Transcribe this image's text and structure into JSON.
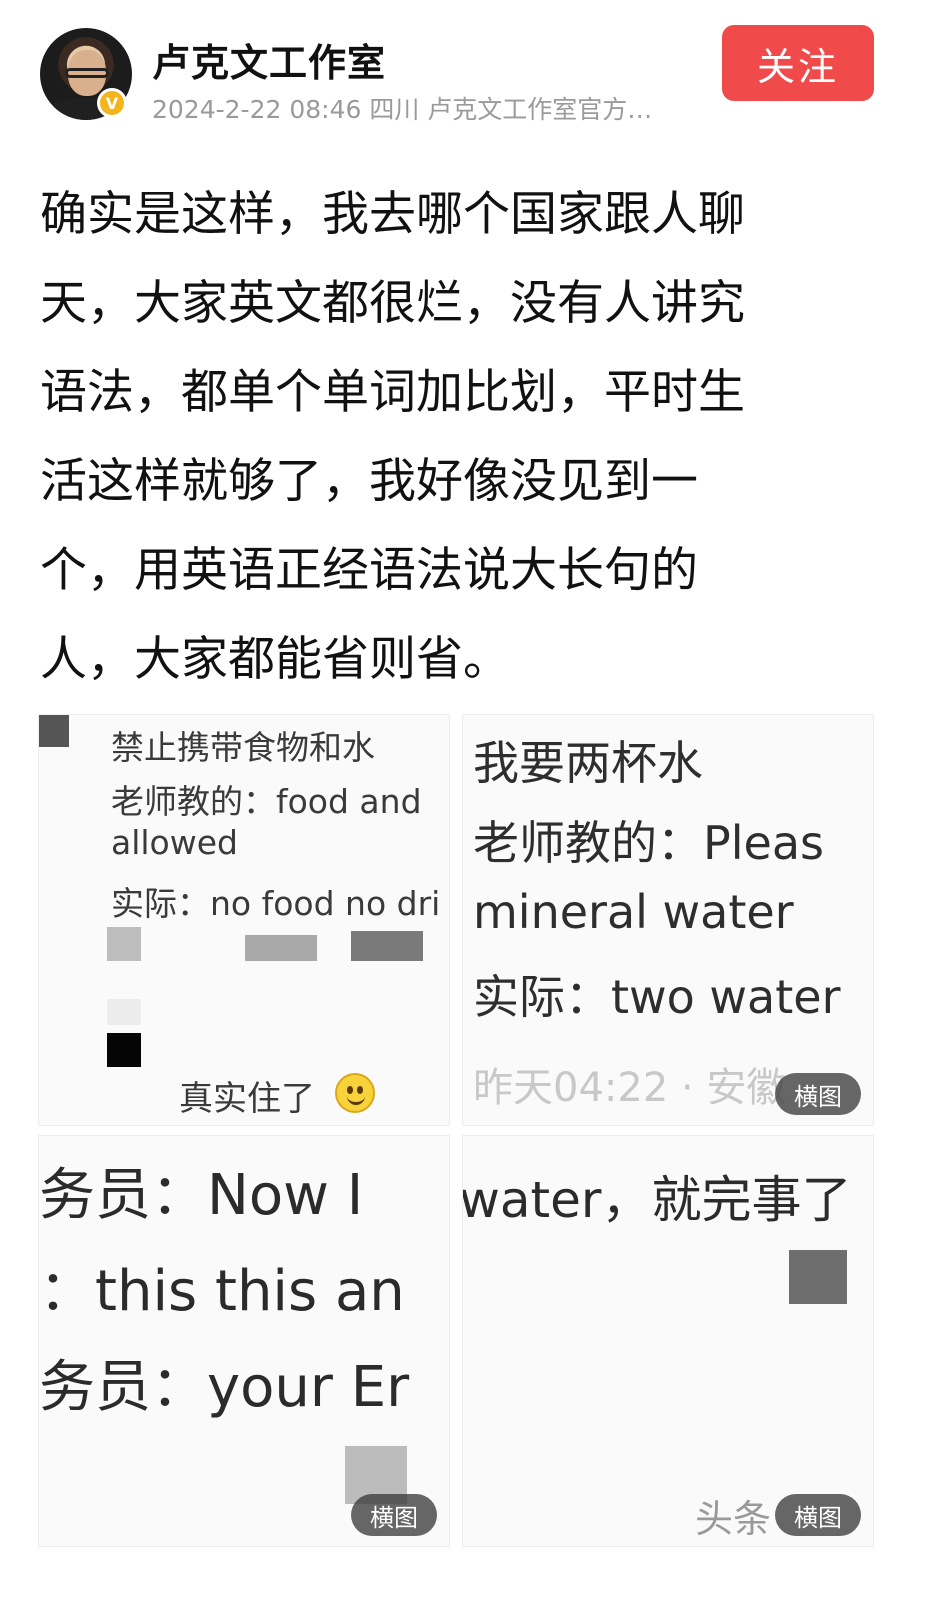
{
  "author": {
    "name": "卢克文工作室",
    "meta": "2024-2-22 08:46 四川 卢克文工作室官方…",
    "verified_badge": "V"
  },
  "follow_button": {
    "label": "关注"
  },
  "post": {
    "lines": [
      "确实是这样，我去哪个国家跟人聊",
      "天，大家英文都很烂，没有人讲究",
      "语法，都单个单词加比划，平时生",
      "活这样就够了，我好像没见到一",
      "个，用英语正经语法说大长句的",
      "人，大家都能省则省。"
    ]
  },
  "images": [
    {
      "lines": [
        "禁止携带食物和水",
        "老师教的：food and",
        "allowed",
        "实际：no food no dri"
      ],
      "caption": "真实住了"
    },
    {
      "lines": [
        "我要两杯水",
        "老师教的：Pleas",
        "mineral water",
        "实际：two water"
      ],
      "timestamp": "昨天04:22 · 安徽",
      "badge": "横图"
    },
    {
      "lines": [
        "服务员：Now I",
        "我：this this an",
        "服务员：your Er"
      ],
      "badge": "横图"
    },
    {
      "lines": [
        "water，就完事了"
      ],
      "footer": "头条",
      "badge": "横图"
    }
  ],
  "colors": {
    "accent": "#f04a4a",
    "verified": "#f3b51b",
    "meta_gray": "#9a9a9a"
  }
}
